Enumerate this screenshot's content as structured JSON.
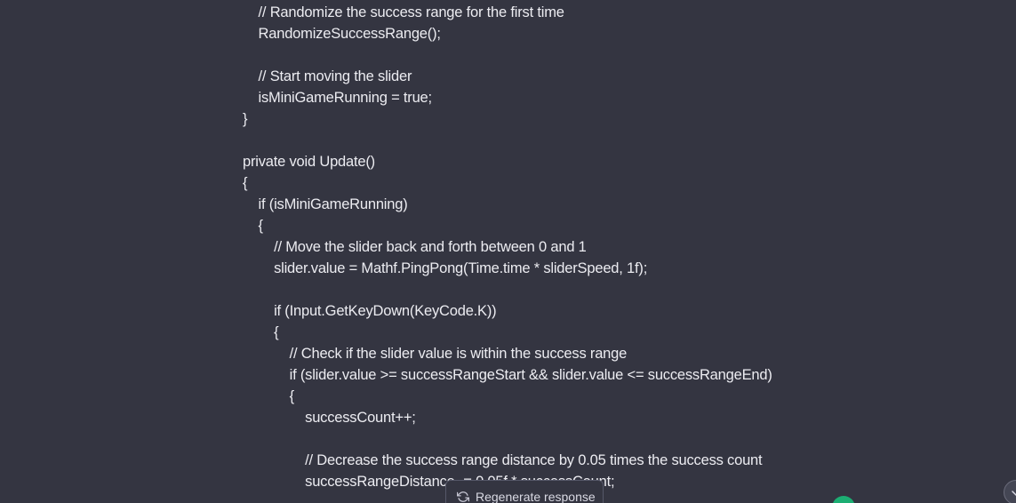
{
  "code": {
    "lines": [
      {
        "text": "    // Randomize the success range for the first time"
      },
      {
        "text": "    RandomizeSuccessRange();"
      },
      {
        "text": ""
      },
      {
        "text": "    // Start moving the slider"
      },
      {
        "text": "    isMiniGameRunning = true;"
      },
      {
        "text": "}"
      },
      {
        "text": ""
      },
      {
        "text": "private void Update()"
      },
      {
        "text": "{"
      },
      {
        "text": "    if (isMiniGameRunning)"
      },
      {
        "text": "    {"
      },
      {
        "text": "        // Move the slider back and forth between 0 and 1"
      },
      {
        "text": "        slider.value = Mathf.PingPong(Time.time * sliderSpeed, 1f);"
      },
      {
        "text": ""
      },
      {
        "text": "        if (Input.GetKeyDown(KeyCode.K))"
      },
      {
        "text": "        {"
      },
      {
        "text": "            // Check if the slider value is within the success range"
      },
      {
        "text": "            if (slider.value >= successRangeStart && slider.value <= successRangeEnd)"
      },
      {
        "text": "            {"
      },
      {
        "text": "                successCount++;"
      },
      {
        "text": ""
      },
      {
        "text": "                // Decrease the success range distance by 0.05 times the success count"
      },
      {
        "text": "                successRangeDistance -= 0.05f * successCount;"
      }
    ]
  },
  "regenerate": {
    "label": "Regenerate response",
    "icon": "refresh-icon"
  },
  "scroll": {
    "icon": "chevron-down-icon"
  },
  "colors": {
    "background": "#343541",
    "text": "#ececf1",
    "accent": "#19c37d"
  }
}
